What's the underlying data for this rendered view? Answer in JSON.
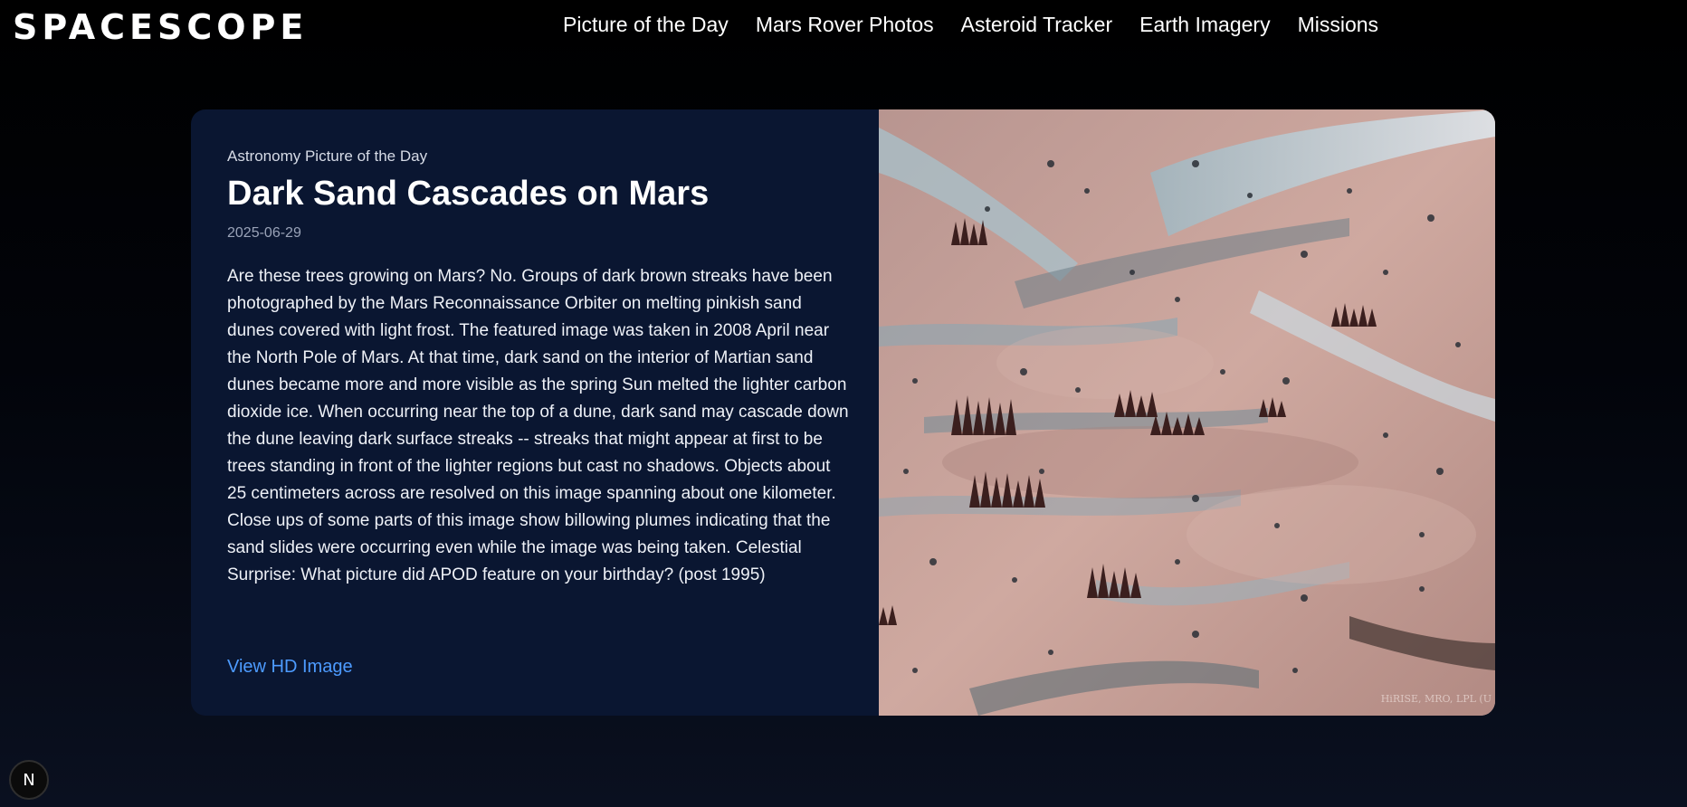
{
  "header": {
    "logo": "SPACESCOPE",
    "nav": [
      {
        "label": "Picture of the Day"
      },
      {
        "label": "Mars Rover Photos"
      },
      {
        "label": "Asteroid Tracker"
      },
      {
        "label": "Earth Imagery"
      },
      {
        "label": "Missions"
      }
    ]
  },
  "apod": {
    "eyebrow": "Astronomy Picture of the Day",
    "title": "Dark Sand Cascades on Mars",
    "date": "2025-06-29",
    "description": "Are these trees growing on Mars? No. Groups of dark brown streaks have been photographed by the Mars Reconnaissance Orbiter on melting pinkish sand dunes covered with light frost. The featured image was taken in 2008 April near the North Pole of Mars. At that time, dark sand on the interior of Martian sand dunes became more and more visible as the spring Sun melted the lighter carbon dioxide ice. When occurring near the top of a dune, dark sand may cascade down the dune leaving dark surface streaks -- streaks that might appear at first to be trees standing in front of the lighter regions but cast no shadows. Objects about 25 centimeters across are resolved on this image spanning about one kilometer. Close ups of some parts of this image show billowing plumes indicating that the sand slides were occurring even while the image was being taken. Celestial Surprise: What picture did APOD feature on your birthday? (post 1995)",
    "link_label": "View HD Image",
    "image_credit": "HiRISE, MRO, LPL (U"
  },
  "badge": {
    "label": "N"
  },
  "colors": {
    "background": "#000000",
    "card": "#0a1631",
    "link": "#4d9bff"
  }
}
